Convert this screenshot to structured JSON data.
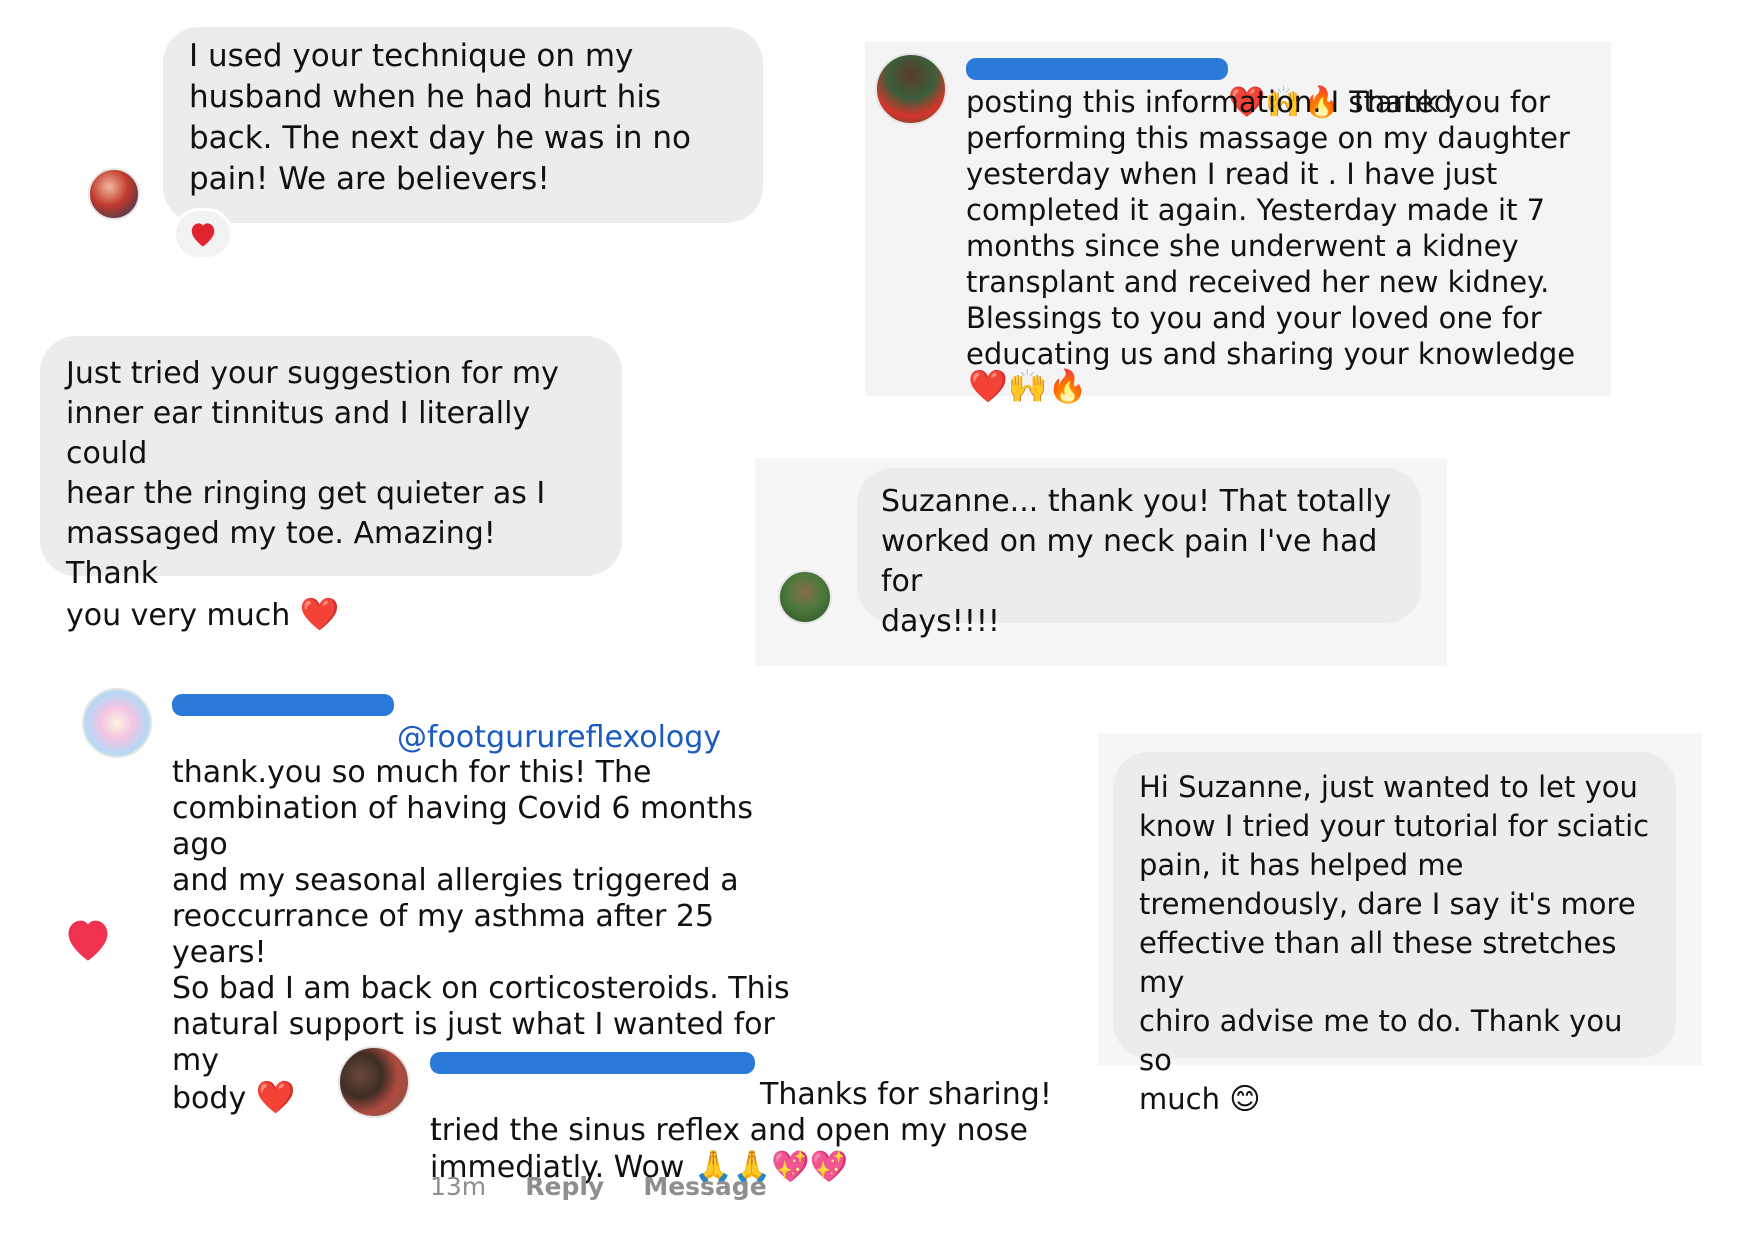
{
  "card1": {
    "text": "I used your technique on my\nhusband when he had hurt his\nback. The next day he was in no\npain!  We are believers!",
    "reaction_icon": "heart-icon"
  },
  "card2": {
    "lead_emojis": "❤️🙌🔥",
    "text_first": "Thank you for",
    "text_rest": "posting this information. I started\nperforming this massage on my daughter\nyesterday when I read it . I have just\ncompleted it again. Yesterday made it 7\nmonths since she underwent a kidney\ntransplant and received her new kidney.\nBlessings to you and your loved one for\neducating us and sharing your knowledge",
    "trail_emojis": "❤️🙌🔥"
  },
  "card3": {
    "text": "Just tried your suggestion for my\ninner ear tinnitus and I literally could\nhear the ringing get quieter as I\nmassaged my toe. Amazing! Thank\nyou very much",
    "emoji": "❤️"
  },
  "card4": {
    "text": "Suzanne... thank you! That totally\nworked on my neck pain I've had for\ndays!!!!"
  },
  "card5": {
    "mention": "@footgurureflexology",
    "text": "thank.you so much for this! The\ncombination of having Covid 6 months ago\nand my seasonal allergies triggered a\nreoccurrance of my asthma after 25 years!\nSo bad I am back on corticosteroids. This\nnatural support is just what I wanted for my\nbody",
    "emoji": "❤️",
    "like_icon": "heart-icon"
  },
  "card6": {
    "text": "Hi Suzanne, just wanted to let you\nknow I tried your tutorial for sciatic\npain, it has helped me\ntremendously, dare I say it's more\neffective than all these stretches my\nchiro advise me to do. Thank you so\nmuch",
    "emoji": "😊"
  },
  "card7": {
    "text_first": "Thanks for sharing! I",
    "text_rest": "tried the sinus reflex and open my nose\nimmediatly. Wow",
    "emojis": "🙏🙏💖💖",
    "time": "13m",
    "reply": "Reply",
    "message": "Message"
  },
  "colors": {
    "bubble": "#ececee",
    "heart": "#e0242f",
    "redaction": "#2a7ad9",
    "mention": "#1b5bbf",
    "meta": "#8e8e8e",
    "like_heart": "#f0314f"
  }
}
